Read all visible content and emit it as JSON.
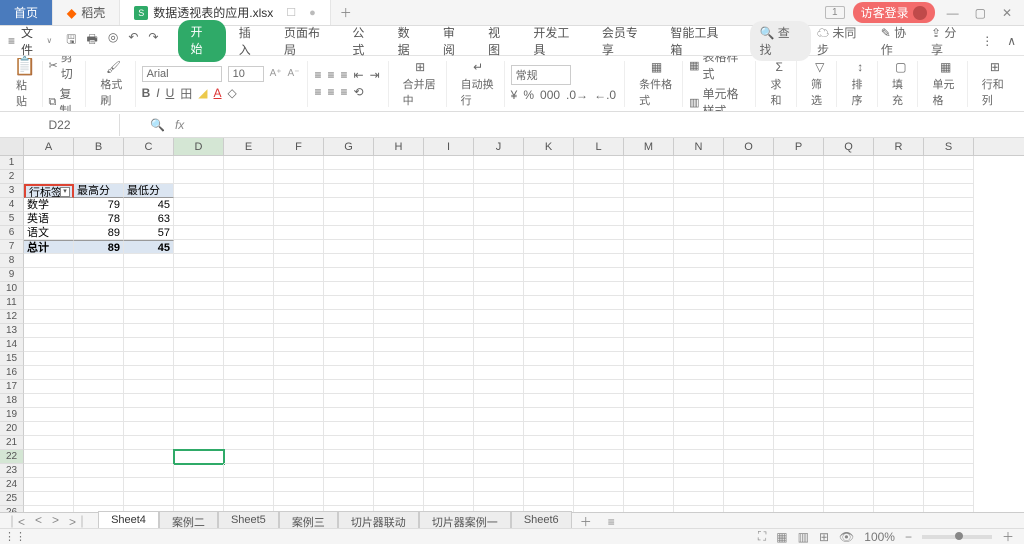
{
  "titlebar": {
    "home_tab": "首页",
    "ke_tab": "稻壳",
    "doc_tab": "数据透视表的应用.xlsx",
    "doc_icon_letter": "S",
    "badge": "1",
    "guest_login": "访客登录"
  },
  "menubar": {
    "file": "文件",
    "tabs": [
      "开始",
      "插入",
      "页面布局",
      "公式",
      "数据",
      "审阅",
      "视图",
      "开发工具",
      "会员专享",
      "智能工具箱"
    ],
    "search": "查找",
    "right": {
      "unsync": "未同步",
      "collab": "协作",
      "share": "分享"
    }
  },
  "ribbon": {
    "paste": "粘贴",
    "cut": "剪切",
    "copy": "复制",
    "format_painter": "格式刷",
    "font": "Arial",
    "size": "10",
    "merge_center": "合并居中",
    "wrap": "自动换行",
    "general": "常规",
    "cond_fmt": "条件格式",
    "table_style": "表格样式",
    "cell_style": "单元格样式",
    "sum": "求和",
    "filter": "筛选",
    "sort": "排序",
    "fill": "填充",
    "cells": "单元格",
    "rowcol": "行和列"
  },
  "formula": {
    "namebox": "D22",
    "fx": "fx"
  },
  "sheet": {
    "columns": [
      "A",
      "B",
      "C",
      "D",
      "E",
      "F",
      "G",
      "H",
      "I",
      "J",
      "K",
      "L",
      "M",
      "N",
      "O",
      "P",
      "Q",
      "R",
      "S"
    ],
    "active_row": 22,
    "active_col": "D",
    "headers_row": 3,
    "headers": {
      "A": "行标签",
      "B": "最高分",
      "C": "最低分"
    },
    "rows": [
      {
        "n": 4,
        "A": "数学",
        "B": 79,
        "C": 45
      },
      {
        "n": 5,
        "A": "英语",
        "B": 78,
        "C": 63
      },
      {
        "n": 6,
        "A": "语文",
        "B": 89,
        "C": 57
      },
      {
        "n": 7,
        "A": "总计",
        "B": 89,
        "C": 45
      }
    ],
    "total_rows": 26
  },
  "sheet_tabs": [
    "Sheet4",
    "案例二",
    "Sheet5",
    "案例三",
    "切片器联动",
    "切片器案例一",
    "Sheet6"
  ],
  "active_sheet": "Sheet4",
  "statusbar": {
    "zoom": "100%"
  }
}
